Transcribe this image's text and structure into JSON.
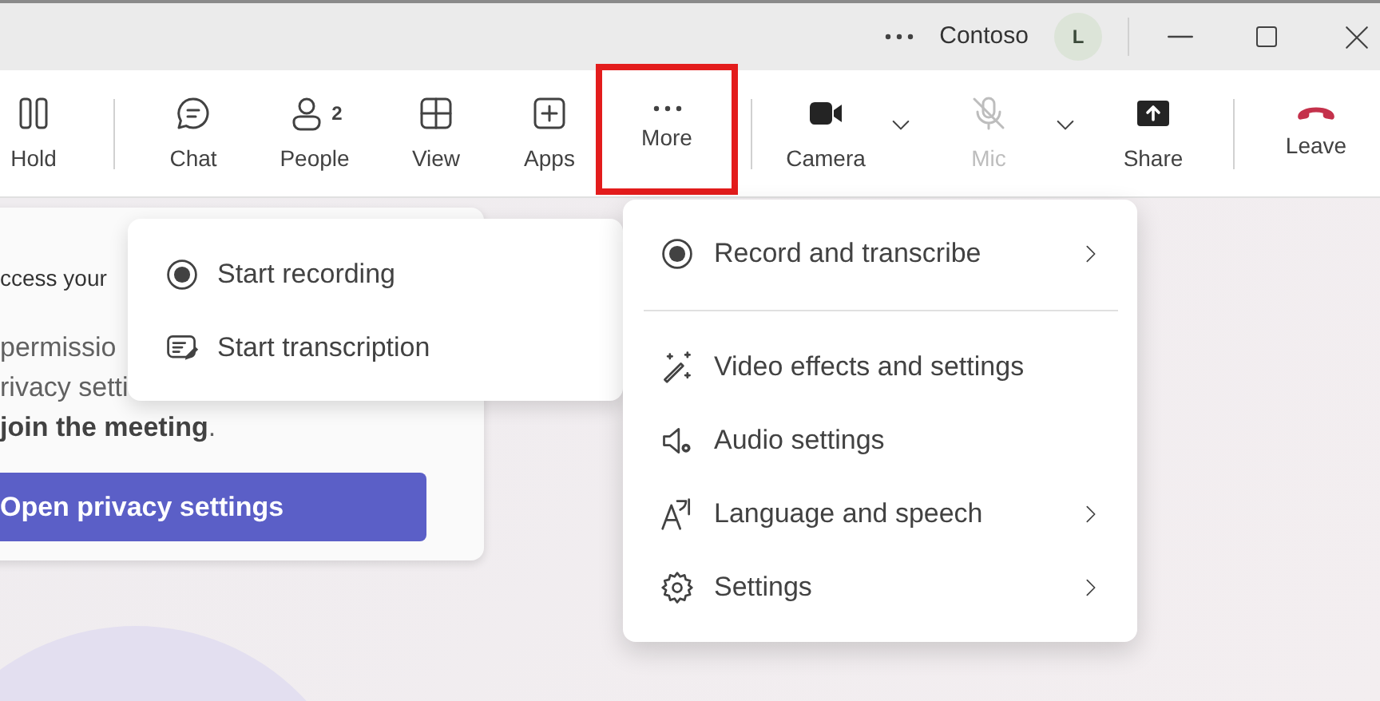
{
  "title_bar": {
    "title": "Contoso",
    "avatar_initial": "L"
  },
  "toolbar": {
    "groups": [
      [
        {
          "label": "Hold",
          "kind": "button",
          "highlighted": false,
          "disabled": false
        }
      ],
      [
        {
          "label": "Chat",
          "kind": "button",
          "highlighted": false,
          "disabled": false
        },
        {
          "label": "People",
          "kind": "button",
          "count": "2",
          "highlighted": false,
          "disabled": false
        },
        {
          "label": "View",
          "kind": "button",
          "highlighted": false,
          "disabled": false
        },
        {
          "label": "Apps",
          "kind": "button",
          "highlighted": false,
          "disabled": false
        },
        {
          "label": "More",
          "kind": "button",
          "highlighted": true,
          "disabled": false
        }
      ],
      [
        {
          "label": "Camera",
          "kind": "button",
          "highlighted": false,
          "disabled": false
        },
        {
          "kind": "chevron",
          "disabled": false
        },
        {
          "label": "Mic",
          "kind": "button",
          "highlighted": false,
          "disabled": true
        },
        {
          "kind": "chevron",
          "disabled": false
        },
        {
          "label": "Share",
          "kind": "button",
          "highlighted": false,
          "disabled": false
        }
      ],
      [
        {
          "label": "Leave",
          "kind": "button",
          "highlighted": false,
          "disabled": false
        }
      ]
    ]
  },
  "privacy_card": {
    "lines": [
      "ccess your",
      "permissio",
      "rivacy setti",
      "**join the meeting**."
    ],
    "button": "Open privacy settings"
  },
  "submenu": {
    "items": [
      {
        "label": "Start recording"
      },
      {
        "label": "Start transcription"
      }
    ]
  },
  "more_menu": {
    "sections": [
      [
        {
          "label": "Record and transcribe",
          "has_submenu": true
        }
      ],
      [
        {
          "label": "Video effects and settings",
          "has_submenu": false
        },
        {
          "label": "Audio settings",
          "has_submenu": false
        },
        {
          "label": "Language and speech",
          "has_submenu": true
        },
        {
          "label": "Settings",
          "has_submenu": true
        }
      ]
    ]
  }
}
